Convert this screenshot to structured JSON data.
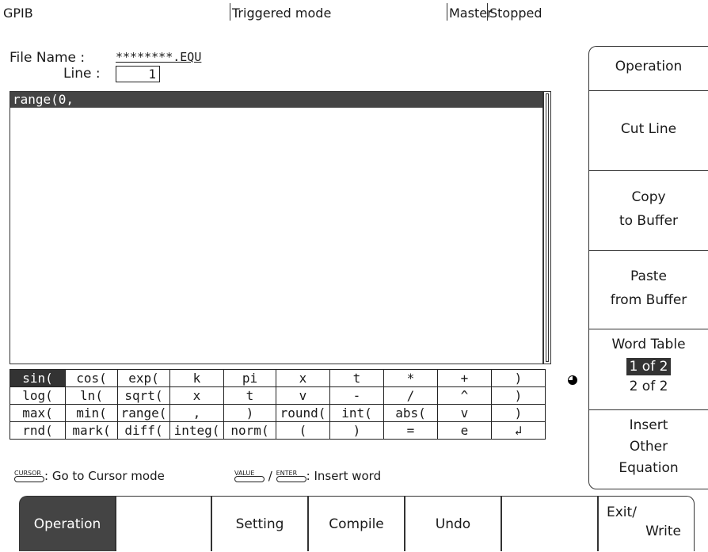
{
  "status_bar": {
    "interface": "GPIB",
    "trigger_mode": "Triggered mode",
    "role": "Master",
    "run_state": "Stopped"
  },
  "file": {
    "name_label": "File Name :",
    "name_value": "********.EQU",
    "line_label": "Line :",
    "line_value": "1"
  },
  "editor": {
    "current_line": "range(0,"
  },
  "word_table": {
    "rows": [
      [
        "sin(",
        "cos(",
        "exp(",
        "k",
        "pi",
        "x",
        "t",
        "*",
        "+",
        ")"
      ],
      [
        "log(",
        "ln(",
        "sqrt(",
        "x",
        "t",
        "v",
        "-",
        "/",
        "^",
        ")"
      ],
      [
        "max(",
        "min(",
        "range(",
        ",",
        ")",
        "round(",
        "int(",
        "abs(",
        "v",
        ")"
      ],
      [
        "rnd(",
        "mark(",
        "diff(",
        "integ(",
        "norm(",
        "(",
        ")",
        "=",
        "e",
        "↲"
      ]
    ],
    "selected": "sin("
  },
  "hints": {
    "cursor_key": "CURSOR",
    "cursor_text": ": Go to Cursor mode",
    "value_key": "VALUE",
    "slash": "/",
    "enter_key": "ENTER",
    "insert_text": ": Insert word"
  },
  "softkeys": {
    "operation": "Operation",
    "cut_line": "Cut Line",
    "copy_1": "Copy",
    "copy_2": "to Buffer",
    "paste_1": "Paste",
    "paste_2": "from Buffer",
    "word_table": "Word Table",
    "page_1": "1 of 2",
    "page_2": "2 of 2",
    "insert_1": "Insert",
    "insert_2": "Other",
    "insert_3": "Equation"
  },
  "tabs": {
    "operation": "Operation",
    "setting": "Setting",
    "compile": "Compile",
    "undo": "Undo",
    "exit_1": "Exit/",
    "exit_2": "Write"
  },
  "colors": {
    "selected_bg": "#333333",
    "active_tab_bg": "#444444"
  }
}
